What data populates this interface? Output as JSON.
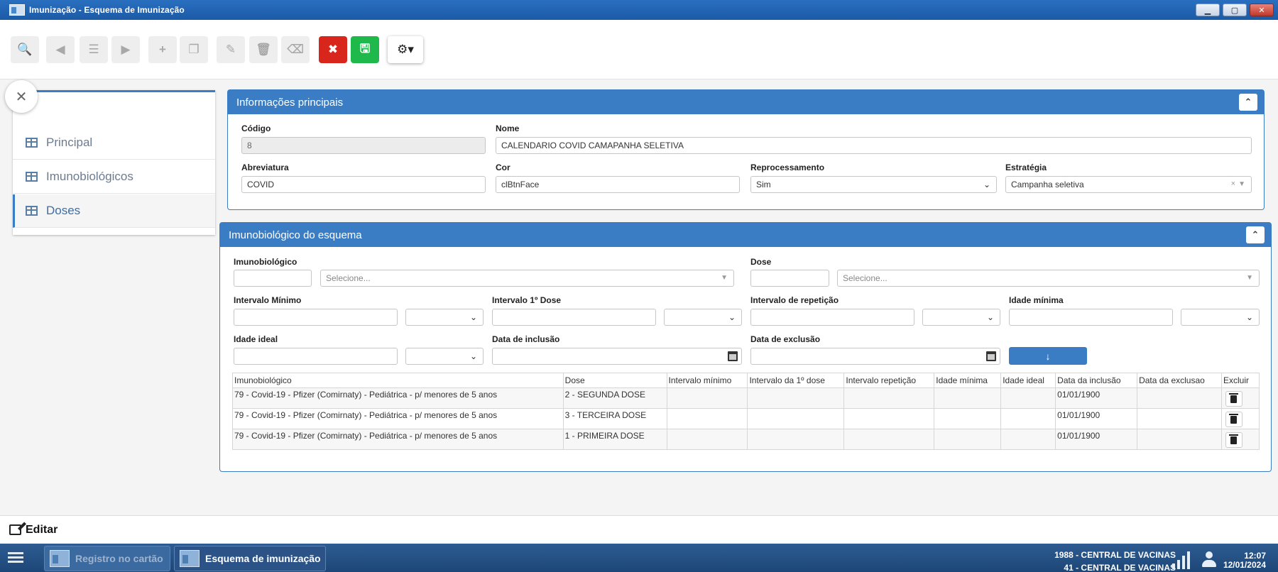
{
  "window": {
    "title": "Imunização - Esquema de Imunização",
    "controls": [
      "minimize",
      "maximize",
      "close"
    ]
  },
  "toolbar": {
    "buttons": [
      {
        "name": "search",
        "icon": "search-icon",
        "glyph": "🔍"
      },
      {
        "name": "previous",
        "icon": "arrow-left-circle-icon",
        "glyph": "◀"
      },
      {
        "name": "list",
        "icon": "list-icon",
        "glyph": "☰"
      },
      {
        "name": "next",
        "icon": "arrow-right-circle-icon",
        "glyph": "▶"
      },
      {
        "name": "new",
        "icon": "plus-icon",
        "glyph": "+"
      },
      {
        "name": "copy",
        "icon": "copy-icon",
        "glyph": "❐"
      },
      {
        "name": "edit",
        "icon": "edit-icon",
        "glyph": "✎"
      },
      {
        "name": "delete",
        "icon": "trash-icon",
        "glyph": "🗑"
      },
      {
        "name": "erase",
        "icon": "eraser-icon",
        "glyph": "⌫"
      },
      {
        "name": "cancel",
        "icon": "cancel-circle-icon",
        "glyph": "✖"
      },
      {
        "name": "save",
        "icon": "save-icon",
        "glyph": "🖫"
      },
      {
        "name": "settings",
        "icon": "gear-icon",
        "glyph": "⚙▾"
      }
    ]
  },
  "sidebar": {
    "close_glyph": "✕",
    "items": [
      {
        "label": "Principal",
        "active": false
      },
      {
        "label": "Imunobiológicos",
        "active": false
      },
      {
        "label": "Doses",
        "active": true
      }
    ]
  },
  "info_panel": {
    "title": "Informações principais",
    "collapse_glyph": "⌃",
    "fields": {
      "codigo": {
        "label": "Código",
        "value": "8"
      },
      "nome": {
        "label": "Nome",
        "value": "CALENDARIO COVID CAMAPANHA SELETIVA"
      },
      "abreviatura": {
        "label": "Abreviatura",
        "value": "COVID"
      },
      "cor": {
        "label": "Cor",
        "value": "clBtnFace"
      },
      "reprocessamento": {
        "label": "Reprocessamento",
        "value": "Sim"
      },
      "estrategia": {
        "label": "Estratégia",
        "value": "Campanha seletiva"
      }
    }
  },
  "imuno_panel": {
    "title": "Imunobiológico do esquema",
    "collapse_glyph": "⌃",
    "labels": {
      "imunobiologico": "Imunobiológico",
      "dose": "Dose",
      "intervalo_minimo": "Intervalo Mínimo",
      "intervalo_1_dose": "Intervalo 1º Dose",
      "intervalo_repeticao": "Intervalo de repetição",
      "idade_minima": "Idade mínima",
      "idade_ideal": "Idade ideal",
      "data_inclusao": "Data de inclusão",
      "data_exclusao": "Data de exclusão"
    },
    "placeholders": {
      "imunobiologico": "Selecione...",
      "dose": "Selecione..."
    },
    "add_glyph": "↓",
    "table": {
      "headers": [
        "Imunobiológico",
        "Dose",
        "Intervalo mínimo",
        "Intervalo da 1º dose",
        "Intervalo repetição",
        "Idade mínima",
        "Idade ideal",
        "Data da inclusão",
        "Data da exclusao",
        "Excluir"
      ],
      "rows": [
        [
          "79 - Covid-19 - Pfizer (Comirnaty) - Pediátrica - p/ menores de 5 anos",
          "2 - SEGUNDA DOSE",
          "",
          "",
          "",
          "",
          "",
          "01/01/1900",
          ""
        ],
        [
          "79 - Covid-19 - Pfizer (Comirnaty) - Pediátrica - p/ menores de 5 anos",
          "3 - TERCEIRA DOSE",
          "",
          "",
          "",
          "",
          "",
          "01/01/1900",
          ""
        ],
        [
          "79 - Covid-19 - Pfizer (Comirnaty) - Pediátrica - p/ menores de 5 anos",
          "1 - PRIMEIRA DOSE",
          "",
          "",
          "",
          "",
          "",
          "01/01/1900",
          ""
        ]
      ]
    }
  },
  "editbar": {
    "label": "Editar"
  },
  "taskbar": {
    "tasks": [
      {
        "label": "Registro no cartão",
        "active": false
      },
      {
        "label": "Esquema de imunização",
        "active": true
      }
    ],
    "unit_line1": "1988 - CENTRAL DE VACINAS",
    "unit_line2": "41 - CENTRAL DE VACINAS",
    "time": "12:07",
    "date": "12/01/2024"
  },
  "colors": {
    "accent": "#3b7dc4",
    "cancel": "#d9261c",
    "save": "#1fb84a",
    "taskbar": "#1d4677"
  }
}
